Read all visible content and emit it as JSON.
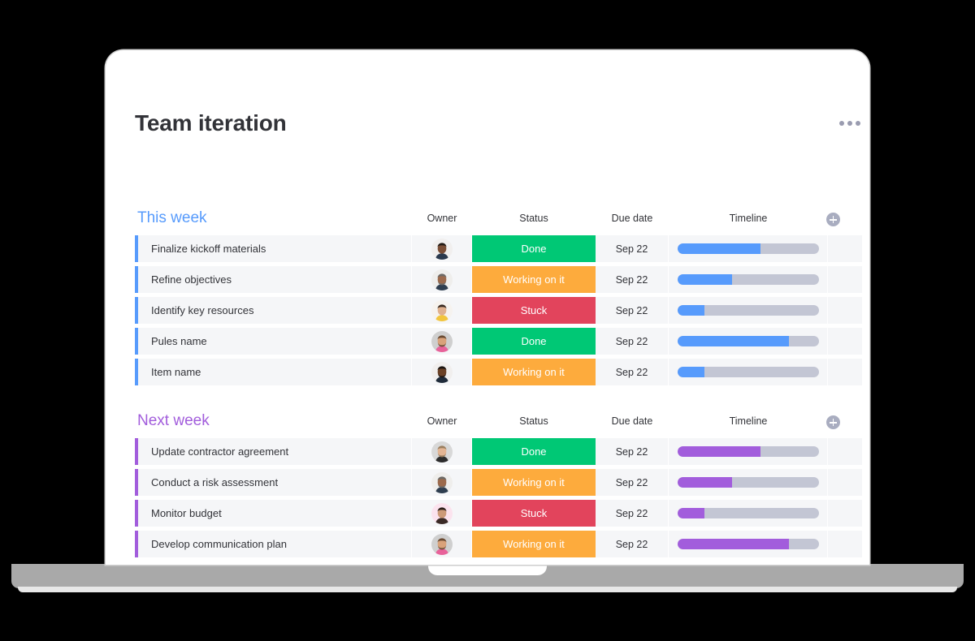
{
  "window": {
    "device": "laptop-mockup",
    "background_color": "#000000",
    "screen_background": "#ffffff"
  },
  "header": {
    "title": "Team iteration",
    "menu_icon": "kebab-menu-icon"
  },
  "columns": {
    "name": "",
    "owner": "Owner",
    "status": "Status",
    "due_date": "Due date",
    "timeline": "Timeline",
    "add_column_icon": "plus-circle-icon"
  },
  "colors": {
    "this_week_accent": "#579bfc",
    "next_week_accent": "#a25ddc",
    "status_done": "#00c875",
    "status_working": "#fdab3d",
    "status_stuck": "#e2445c",
    "row_background": "#f5f6f8",
    "timeline_track": "#c3c6d4",
    "title_text": "#323338"
  },
  "groups": [
    {
      "title": "This week",
      "accent": "#579bfc",
      "rows": [
        {
          "name": "Finalize kickoff materials",
          "owner": "avatar-man-short-hair",
          "status": "Done",
          "status_color": "#00c875",
          "due_date": "Sep 22",
          "timeline_percent": 59
        },
        {
          "name": "Refine objectives",
          "owner": "avatar-man-beard-gray",
          "status": "Working on it",
          "status_color": "#fdab3d",
          "due_date": "Sep 22",
          "timeline_percent": 39
        },
        {
          "name": "Identify key resources",
          "owner": "avatar-woman-blonde",
          "status": "Stuck",
          "status_color": "#e2445c",
          "due_date": "Sep 22",
          "timeline_percent": 19
        },
        {
          "name": "Pules name",
          "owner": "avatar-man-beard-floral",
          "status": "Done",
          "status_color": "#00c875",
          "due_date": "Sep 22",
          "timeline_percent": 79
        },
        {
          "name": "Item name",
          "owner": "avatar-man-dark-shirt",
          "status": "Working on it",
          "status_color": "#fdab3d",
          "due_date": "Sep 22",
          "timeline_percent": 19
        }
      ]
    },
    {
      "title": "Next week",
      "accent": "#a25ddc",
      "rows": [
        {
          "name": "Update contractor agreement",
          "owner": "avatar-man-light-beard",
          "status": "Done",
          "status_color": "#00c875",
          "due_date": "Sep 22",
          "timeline_percent": 59
        },
        {
          "name": "Conduct a risk assessment",
          "owner": "avatar-man-beard-gray",
          "status": "Working on it",
          "status_color": "#fdab3d",
          "due_date": "Sep 22",
          "timeline_percent": 39
        },
        {
          "name": "Monitor budget",
          "owner": "avatar-woman-dark-hair",
          "status": "Stuck",
          "status_color": "#e2445c",
          "due_date": "Sep 22",
          "timeline_percent": 19
        },
        {
          "name": "Develop communication plan",
          "owner": "avatar-man-beard-floral",
          "status": "Working on it",
          "status_color": "#fdab3d",
          "due_date": "Sep 22",
          "timeline_percent": 79
        }
      ]
    }
  ]
}
